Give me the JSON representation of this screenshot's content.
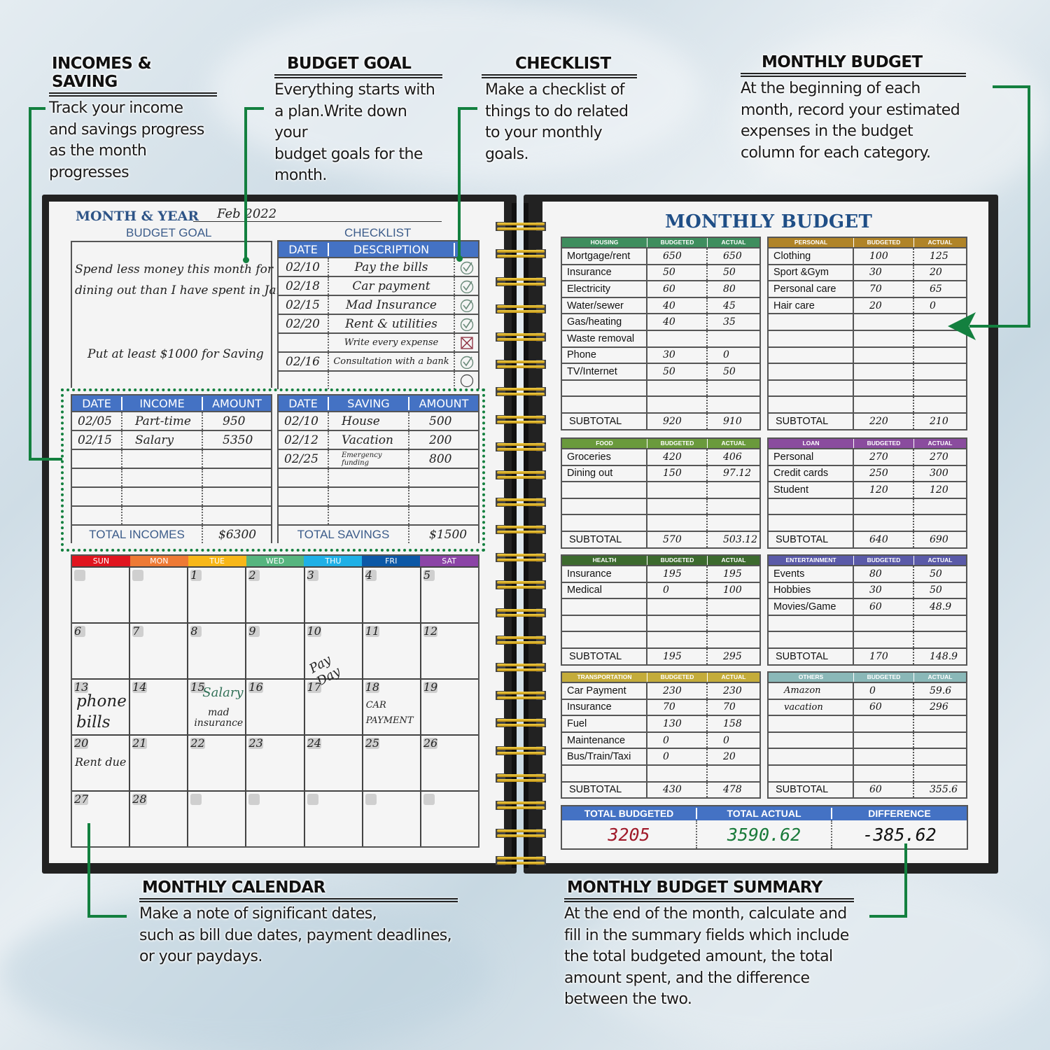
{
  "callouts": {
    "incomes_saving": {
      "title": "INCOMES & SAVING",
      "lines": [
        "Track your income",
        "and savings progress",
        "as the month progresses"
      ]
    },
    "budget_goal": {
      "title": "BUDGET GOAL",
      "lines": [
        "Everything starts with",
        "a plan.Write down your",
        "budget goals for the",
        "month."
      ]
    },
    "checklist": {
      "title": "CHECKLIST",
      "lines": [
        "Make a checklist of",
        "things to do related",
        "to your monthly goals."
      ]
    },
    "monthly_budget": {
      "title": "MONTHLY BUDGET",
      "lines": [
        "At the beginning of each",
        "month, record your estimated",
        "expenses in the budget",
        "column for each category."
      ]
    },
    "monthly_calendar": {
      "title": "MONTHLY CALENDAR",
      "lines": [
        "Make a note of significant dates,",
        "such as bill due dates, payment deadlines,",
        "or your paydays."
      ]
    },
    "budget_summary": {
      "title": "MONTHLY BUDGET SUMMARY",
      "lines": [
        "At the end of the month, calculate and",
        "fill in the summary fields which include",
        "the total budgeted amount, the total",
        "amount spent, and the difference",
        "between the two."
      ]
    }
  },
  "left_page": {
    "month_year_label": "MONTH & YEAR",
    "month_year_value": "Feb 2022",
    "budget_goal": {
      "title": "BUDGET GOAL",
      "goals": [
        "Spend less money this month for",
        "dining out than I have spent in Jan",
        "Put at least $1000 for Saving"
      ]
    },
    "checklist": {
      "title": "CHECKLIST",
      "headers": [
        "DATE",
        "DESCRIPTION",
        ""
      ],
      "rows": [
        {
          "date": "02/10",
          "description": "Pay the bills",
          "status": "done"
        },
        {
          "date": "02/18",
          "description": "Car payment",
          "status": "done"
        },
        {
          "date": "02/15",
          "description": "Mad Insurance",
          "status": "done"
        },
        {
          "date": "02/20",
          "description": "Rent & utilities",
          "status": "done"
        },
        {
          "date": "",
          "description": "Write every expense",
          "status": "failed"
        },
        {
          "date": "02/16",
          "description": "Consultation with a bank",
          "status": "done"
        },
        {
          "date": "",
          "description": "",
          "status": "empty"
        }
      ]
    },
    "income": {
      "headers": [
        "DATE",
        "INCOME",
        "AMOUNT"
      ],
      "rows": [
        {
          "date": "02/05",
          "name": "Part-time",
          "amount": "950"
        },
        {
          "date": "02/15",
          "name": "Salary",
          "amount": "5350"
        },
        {
          "date": "",
          "name": "",
          "amount": ""
        },
        {
          "date": "",
          "name": "",
          "amount": ""
        },
        {
          "date": "",
          "name": "",
          "amount": ""
        },
        {
          "date": "",
          "name": "",
          "amount": ""
        }
      ],
      "total_label": "TOTAL INCOMES",
      "total_value": "$6300"
    },
    "saving": {
      "headers": [
        "DATE",
        "SAVING",
        "AMOUNT"
      ],
      "rows": [
        {
          "date": "02/10",
          "name": "House",
          "amount": "500"
        },
        {
          "date": "02/12",
          "name": "Vacation",
          "amount": "200"
        },
        {
          "date": "02/25",
          "name": "Emergency funding",
          "amount": "800"
        },
        {
          "date": "",
          "name": "",
          "amount": ""
        },
        {
          "date": "",
          "name": "",
          "amount": ""
        },
        {
          "date": "",
          "name": "",
          "amount": ""
        }
      ],
      "total_label": "TOTAL SAVINGS",
      "total_value": "$1500"
    },
    "calendar": {
      "days": [
        {
          "label": "SUN",
          "color": "#e0151f"
        },
        {
          "label": "MON",
          "color": "#ee7a35"
        },
        {
          "label": "TUE",
          "color": "#f7b719"
        },
        {
          "label": "WED",
          "color": "#56b57f"
        },
        {
          "label": "THU",
          "color": "#1fb0e6"
        },
        {
          "label": "FRI",
          "color": "#0c58a6"
        },
        {
          "label": "SAT",
          "color": "#8b44a6"
        }
      ],
      "weeks": [
        [
          {
            "n": ""
          },
          {
            "n": ""
          },
          {
            "n": "1"
          },
          {
            "n": "2"
          },
          {
            "n": "3"
          },
          {
            "n": "4"
          },
          {
            "n": "5"
          }
        ],
        [
          {
            "n": "6"
          },
          {
            "n": "7"
          },
          {
            "n": "8"
          },
          {
            "n": "9"
          },
          {
            "n": "10",
            "note": "Pay Day"
          },
          {
            "n": "11"
          },
          {
            "n": "12"
          }
        ],
        [
          {
            "n": "13",
            "note": "phone bills"
          },
          {
            "n": "14"
          },
          {
            "n": "15",
            "note": "Salary",
            "note2": "mad insurance"
          },
          {
            "n": "16"
          },
          {
            "n": "17"
          },
          {
            "n": "18",
            "note": "CAR PAYMENT"
          },
          {
            "n": "19"
          }
        ],
        [
          {
            "n": "20",
            "note": "Rent due"
          },
          {
            "n": "21"
          },
          {
            "n": "22"
          },
          {
            "n": "23"
          },
          {
            "n": "24"
          },
          {
            "n": "25"
          },
          {
            "n": "26"
          }
        ],
        [
          {
            "n": "27"
          },
          {
            "n": "28"
          },
          {
            "n": ""
          },
          {
            "n": ""
          },
          {
            "n": ""
          },
          {
            "n": ""
          },
          {
            "n": ""
          }
        ]
      ]
    }
  },
  "right_page": {
    "title": "MONTHLY BUDGET",
    "col_budgeted": "BUDGETED",
    "col_actual": "ACTUAL",
    "subtotal_label": "SUBTOTAL",
    "categories": [
      {
        "name": "HOUSING",
        "color": "#3e8e5e",
        "rows": [
          [
            "Mortgage/rent",
            "650",
            "650"
          ],
          [
            "Insurance",
            "50",
            "50"
          ],
          [
            "Electricity",
            "60",
            "80"
          ],
          [
            "Water/sewer",
            "40",
            "45"
          ],
          [
            "Gas/heating",
            "40",
            "35"
          ],
          [
            "Waste removal",
            "",
            ""
          ],
          [
            "Phone",
            "30",
            "0"
          ],
          [
            "TV/Internet",
            "50",
            "50"
          ],
          [
            "",
            "",
            ""
          ],
          [
            "",
            "",
            ""
          ]
        ],
        "subtotal": [
          "920",
          "910"
        ]
      },
      {
        "name": "PERSONAL",
        "color": "#b08428",
        "rows": [
          [
            "Clothing",
            "100",
            "125"
          ],
          [
            "Sport &Gym",
            "30",
            "20"
          ],
          [
            "Personal care",
            "70",
            "65"
          ],
          [
            "Hair care",
            "20",
            "0"
          ],
          [
            "",
            "",
            ""
          ],
          [
            "",
            "",
            ""
          ],
          [
            "",
            "",
            ""
          ],
          [
            "",
            "",
            ""
          ],
          [
            "",
            "",
            ""
          ],
          [
            "",
            "",
            ""
          ]
        ],
        "subtotal": [
          "220",
          "210"
        ]
      },
      {
        "name": "FOOD",
        "color": "#6a9a3c",
        "rows": [
          [
            "Groceries",
            "420",
            "406"
          ],
          [
            "Dining out",
            "150",
            "97.12"
          ],
          [
            "",
            "",
            ""
          ],
          [
            "",
            "",
            ""
          ],
          [
            "",
            "",
            ""
          ]
        ],
        "subtotal": [
          "570",
          "503.12"
        ]
      },
      {
        "name": "LOAN",
        "color": "#8a4c9e",
        "rows": [
          [
            "Personal",
            "270",
            "270"
          ],
          [
            "Credit cards",
            "250",
            "300"
          ],
          [
            "Student",
            "120",
            "120"
          ],
          [
            "",
            "",
            ""
          ],
          [
            "",
            "",
            ""
          ]
        ],
        "subtotal": [
          "640",
          "690"
        ]
      },
      {
        "name": "HEALTH",
        "color": "#3c6a2e",
        "rows": [
          [
            "Insurance",
            "195",
            "195"
          ],
          [
            "Medical",
            "0",
            "100"
          ],
          [
            "",
            "",
            ""
          ],
          [
            "",
            "",
            ""
          ],
          [
            "",
            "",
            ""
          ]
        ],
        "subtotal": [
          "195",
          "295"
        ]
      },
      {
        "name": "ENTERTAINMENT",
        "color": "#5a5aa8",
        "rows": [
          [
            "Events",
            "80",
            "50"
          ],
          [
            "Hobbies",
            "30",
            "50"
          ],
          [
            "Movies/Game",
            "60",
            "48.9"
          ],
          [
            "",
            "",
            ""
          ],
          [
            "",
            "",
            ""
          ]
        ],
        "subtotal": [
          "170",
          "148.9"
        ]
      },
      {
        "name": "TRANSPORTATION",
        "color": "#c4ac3a",
        "rows": [
          [
            "Car Payment",
            "230",
            "230"
          ],
          [
            "Insurance",
            "70",
            "70"
          ],
          [
            "Fuel",
            "130",
            "158"
          ],
          [
            "Maintenance",
            "0",
            "0"
          ],
          [
            "Bus/Train/Taxi",
            "0",
            "20"
          ],
          [
            "",
            "",
            ""
          ]
        ],
        "subtotal": [
          "430",
          "478"
        ]
      },
      {
        "name": "OTHERS",
        "color": "#8ab8b8",
        "rows": [
          [
            "Amazon",
            "0",
            "59.6"
          ],
          [
            "vacation",
            "60",
            "296"
          ],
          [
            "",
            "",
            ""
          ],
          [
            "",
            "",
            ""
          ],
          [
            "",
            "",
            ""
          ],
          [
            "",
            "",
            ""
          ]
        ],
        "subtotal": [
          "60",
          "355.6"
        ]
      }
    ],
    "summary": {
      "headers": [
        "TOTAL BUDGETED",
        "TOTAL ACTUAL",
        "DIFFERENCE"
      ],
      "values": [
        "3205",
        "3590.62",
        "-385.62"
      ],
      "colors": [
        "#a01a2a",
        "#1a7a3a",
        "#111111"
      ]
    }
  }
}
